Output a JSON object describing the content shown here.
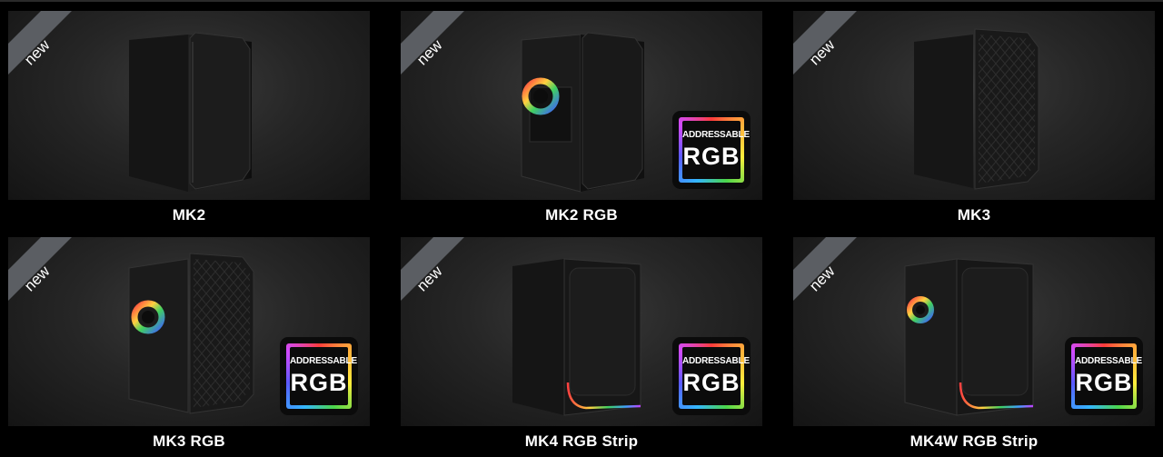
{
  "products": [
    {
      "name": "MK2",
      "is_new": true,
      "badge": false
    },
    {
      "name": "MK2 RGB",
      "is_new": true,
      "badge": true
    },
    {
      "name": "MK3",
      "is_new": true,
      "badge": false
    },
    {
      "name": "MK3 RGB",
      "is_new": true,
      "badge": true
    },
    {
      "name": "MK4 RGB Strip",
      "is_new": true,
      "badge": true
    },
    {
      "name": "MK4W RGB Strip",
      "is_new": true,
      "badge": true
    }
  ],
  "ribbon_text": "new",
  "badge": {
    "line1": "ADDRESSABLE",
    "line2": "RGB"
  }
}
